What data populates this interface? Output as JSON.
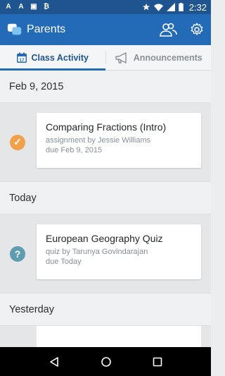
{
  "status_bar": {
    "left_icons": [
      "A",
      "A",
      "▣",
      "₿"
    ],
    "time": "2:32"
  },
  "app": {
    "title": "Parents"
  },
  "tabs": [
    {
      "label": "Class Activity",
      "active": true,
      "icon": "calendar-icon",
      "icon_text": "17"
    },
    {
      "label": "Announcements",
      "active": false,
      "icon": "megaphone-icon"
    }
  ],
  "sections": [
    {
      "header": "Feb 9, 2015",
      "item": {
        "status": "done",
        "status_glyph": "✓",
        "title": "Comparing Fractions (Intro)",
        "byline": "assignment by Jessie Williams",
        "due": "due Feb 9, 2015"
      }
    },
    {
      "header": "Today",
      "item": {
        "status": "unknown",
        "status_glyph": "?",
        "title": "European Geography Quiz",
        "byline": "quiz by Tarunya Govindarajan",
        "due": "due Today"
      }
    },
    {
      "header": "Yesterday"
    }
  ],
  "colors": {
    "status_bar": "#1e5591",
    "app_bar": "#236bb7",
    "done": "#f0a14a",
    "unknown": "#5e9cb0"
  }
}
